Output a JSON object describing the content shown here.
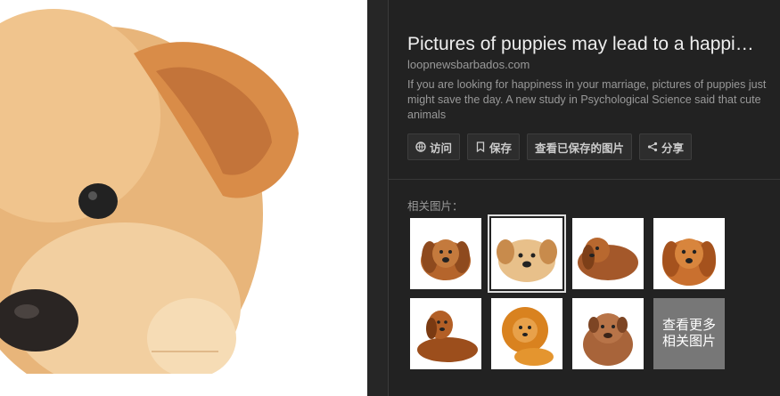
{
  "result": {
    "title": "Pictures of puppies may lead to a happi…",
    "domain": "loopnewsbarbados.com",
    "description": "If you are looking for happiness in your marriage, pictures of puppies just might save the day. A new study in Psychological Science said that cute animals"
  },
  "buttons": {
    "visit": "访问",
    "save": "保存",
    "view_saved": "查看已保存的图片",
    "share": "分享"
  },
  "related": {
    "label": "相关图片：",
    "more": "查看更多相关图片",
    "thumbnails": [
      "golden-retriever-puppy-lying",
      "yellow-puppy-lying",
      "cocker-spaniel-puppy-lying",
      "red-retriever-puppy",
      "golden-retriever-dog-lying",
      "dog-with-lion-mane",
      "dogue-de-bordeaux-puppy"
    ]
  },
  "icons": {
    "visit": "globe-icon",
    "save": "bookmark-icon",
    "share": "share-icon"
  }
}
